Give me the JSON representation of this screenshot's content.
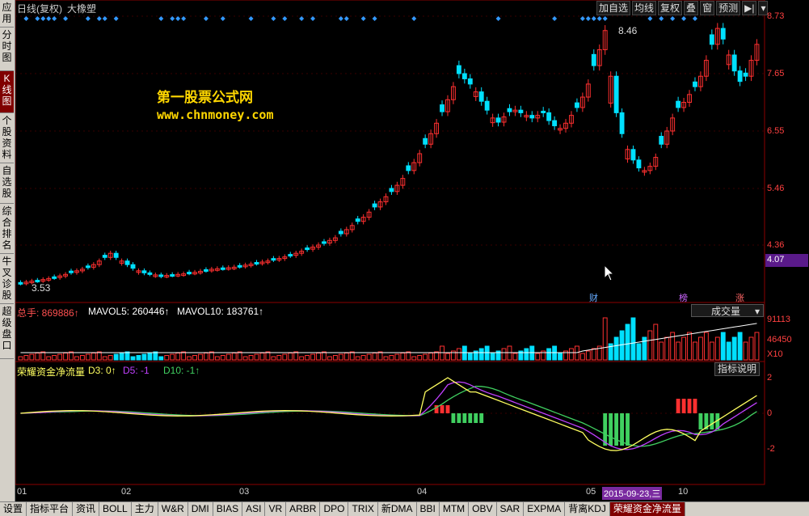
{
  "side_tabs": [
    "应用",
    "分时图",
    "K线图",
    "个股资料",
    "自选股",
    "综合排名",
    "牛叉诊股",
    "超级盘口"
  ],
  "header": {
    "chart_title": "日线(复权)",
    "stock_name": "大橡塑"
  },
  "topbar": [
    "加自选",
    "均线",
    "复权",
    "叠",
    "窗",
    "预测",
    "▶|",
    "▾"
  ],
  "price_axis": [
    "8.73",
    "7.65",
    "6.55",
    "5.46",
    "4.36"
  ],
  "price_current": "4.07",
  "annot_high": "8.46",
  "annot_low": "3.53",
  "watermark": {
    "line1": "第一股票公式网",
    "line2": "www.chnmoney.com"
  },
  "markers": {
    "cai": "财",
    "bang": "榜",
    "zhang": "涨"
  },
  "volume": {
    "total_label": "总手: 869886↑",
    "ma5_label": "MAVOL5: 260446↑",
    "ma10_label": "MAVOL10: 183761↑",
    "dropdown": "成交量",
    "axis_top": "91113",
    "axis_mid": "46450",
    "axis_unit": "X10"
  },
  "indicator": {
    "name": "荣耀资金净流量",
    "d3": "D3: 0↑",
    "d5": "D5: -1",
    "d10": "D10: -1↑",
    "button": "指标说明",
    "axis": [
      "2",
      "0",
      "-2"
    ]
  },
  "x_dates": [
    "01",
    "02",
    "03",
    "04",
    "05",
    "10"
  ],
  "cursor_date": "2015-09-23,三",
  "bottom_tabs": [
    "设置",
    "指标平台",
    "资讯",
    "BOLL",
    "主力",
    "W&R",
    "DMI",
    "BIAS",
    "ASI",
    "VR",
    "ARBR",
    "DPO",
    "TRIX",
    "新DMA",
    "BBI",
    "MTM",
    "OBV",
    "SAR",
    "EXPMA",
    "背离KDJ",
    "荣耀资金净流量"
  ],
  "colors": {
    "up": "#ff3030",
    "down": "#00e0ff",
    "ma5": "#ffffff",
    "ma10": "#ffff40",
    "indicator_yellow": "#ffff60",
    "indicator_violet": "#c040ff",
    "indicator_green": "#40d060"
  },
  "chart_data": {
    "type": "candlestick",
    "price_ticks": [
      8.73,
      7.65,
      6.55,
      5.46,
      4.36
    ],
    "closes": [
      3.62,
      3.64,
      3.66,
      3.67,
      3.69,
      3.71,
      3.73,
      3.76,
      3.79,
      3.83,
      3.86,
      3.89,
      3.93,
      3.98,
      4.05,
      4.12,
      4.2,
      4.12,
      4.05,
      3.98,
      3.91,
      3.86,
      3.82,
      3.8,
      3.78,
      3.76,
      3.77,
      3.78,
      3.79,
      3.8,
      3.82,
      3.83,
      3.85,
      3.87,
      3.89,
      3.9,
      3.91,
      3.92,
      3.93,
      3.95,
      3.97,
      3.99,
      4.01,
      4.03,
      4.05,
      4.08,
      4.1,
      4.13,
      4.16,
      4.2,
      4.24,
      4.28,
      4.32,
      4.36,
      4.4,
      4.45,
      4.5,
      4.58,
      4.66,
      4.74,
      4.82,
      4.9,
      5.0,
      5.1,
      5.2,
      5.3,
      5.4,
      5.52,
      5.65,
      5.8,
      5.95,
      6.12,
      6.3,
      6.5,
      6.7,
      6.92,
      7.15,
      7.4,
      7.65,
      7.55,
      7.45,
      7.3,
      7.12,
      6.95,
      6.8,
      6.72,
      6.82,
      6.92,
      6.95,
      6.9,
      6.85,
      6.8,
      6.85,
      6.9,
      6.75,
      6.65,
      6.6,
      6.7,
      6.85,
      7.0,
      7.2,
      7.45,
      7.8,
      8.1,
      8.46,
      7.6,
      6.9,
      6.5,
      6.2,
      6.0,
      5.85,
      5.8,
      5.88,
      6.05,
      6.3,
      6.55,
      6.8,
      7.0,
      7.1,
      7.25,
      7.4,
      7.6,
      7.9,
      8.2,
      8.5,
      8.3,
      8.0,
      7.7,
      7.5,
      7.6,
      7.9,
      8.2
    ],
    "volume_axis": [
      91113,
      46450
    ],
    "indicator_axis": [
      2,
      0,
      -2
    ]
  }
}
